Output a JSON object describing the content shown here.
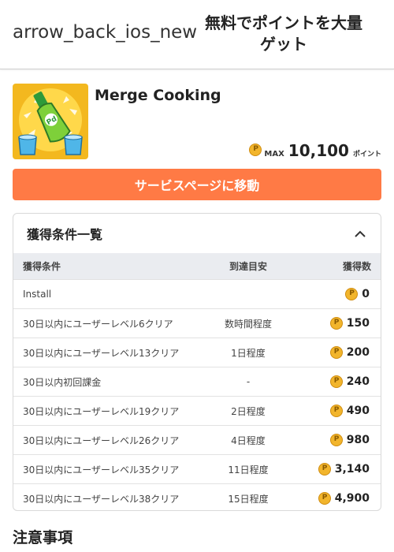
{
  "header": {
    "back_label": "arrow_back_ios_new",
    "title": "無料でポイントを大量ゲット"
  },
  "app": {
    "name": "Merge Cooking",
    "max_label": "MAX",
    "max_points": "10,100",
    "points_unit": "ポイント"
  },
  "service_button_label": "サービスページに移動",
  "conditions": {
    "title": "獲得条件一覧",
    "headers": {
      "condition": "獲得条件",
      "target": "到達目安",
      "points": "獲得数"
    },
    "rows": [
      {
        "condition": "Install",
        "target": "",
        "points": "0"
      },
      {
        "condition": "30日以内にユーザーレベル6クリア",
        "target": "数時間程度",
        "points": "150"
      },
      {
        "condition": "30日以内にユーザーレベル13クリア",
        "target": "1日程度",
        "points": "200"
      },
      {
        "condition": "30日以内初回課金",
        "target": "-",
        "points": "240"
      },
      {
        "condition": "30日以内にユーザーレベル19クリア",
        "target": "2日程度",
        "points": "490"
      },
      {
        "condition": "30日以内にユーザーレベル26クリア",
        "target": "4日程度",
        "points": "980"
      },
      {
        "condition": "30日以内にユーザーレベル35クリア",
        "target": "11日程度",
        "points": "3,140"
      },
      {
        "condition": "30日以内にユーザーレベル38クリア",
        "target": "15日程度",
        "points": "4,900"
      }
    ]
  },
  "notes_title": "注意事項",
  "colors": {
    "accent": "#ff7a45",
    "coin": "#f2b52c",
    "table_header_bg": "#eaecf0"
  }
}
